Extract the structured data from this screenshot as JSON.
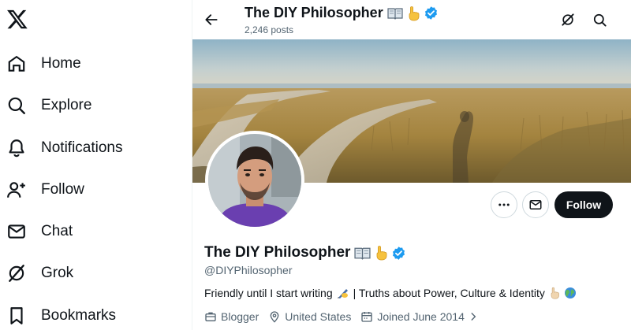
{
  "nav": {
    "logo_icon": "x-logo-icon",
    "items": [
      {
        "label": "Home",
        "icon": "home-icon"
      },
      {
        "label": "Explore",
        "icon": "search-icon"
      },
      {
        "label": "Notifications",
        "icon": "bell-icon"
      },
      {
        "label": "Follow",
        "icon": "add-person-icon"
      },
      {
        "label": "Chat",
        "icon": "mail-icon"
      },
      {
        "label": "Grok",
        "icon": "grok-icon"
      },
      {
        "label": "Bookmarks",
        "icon": "bookmark-icon"
      }
    ]
  },
  "header": {
    "title": "The DIY Philosopher",
    "post_count": "2,246 posts"
  },
  "profile": {
    "name": "The DIY Philosopher",
    "handle": "@DIYPhilosopher",
    "bio_part1": "Friendly until I start writing",
    "bio_part2": "| Truths about Power, Culture & Identity",
    "category": "Blogger",
    "location": "United States",
    "joined": "Joined June 2014",
    "follow_label": "Follow"
  },
  "colors": {
    "verified": "#1d9bf0",
    "text": "#0f1419",
    "secondary": "#536471"
  }
}
